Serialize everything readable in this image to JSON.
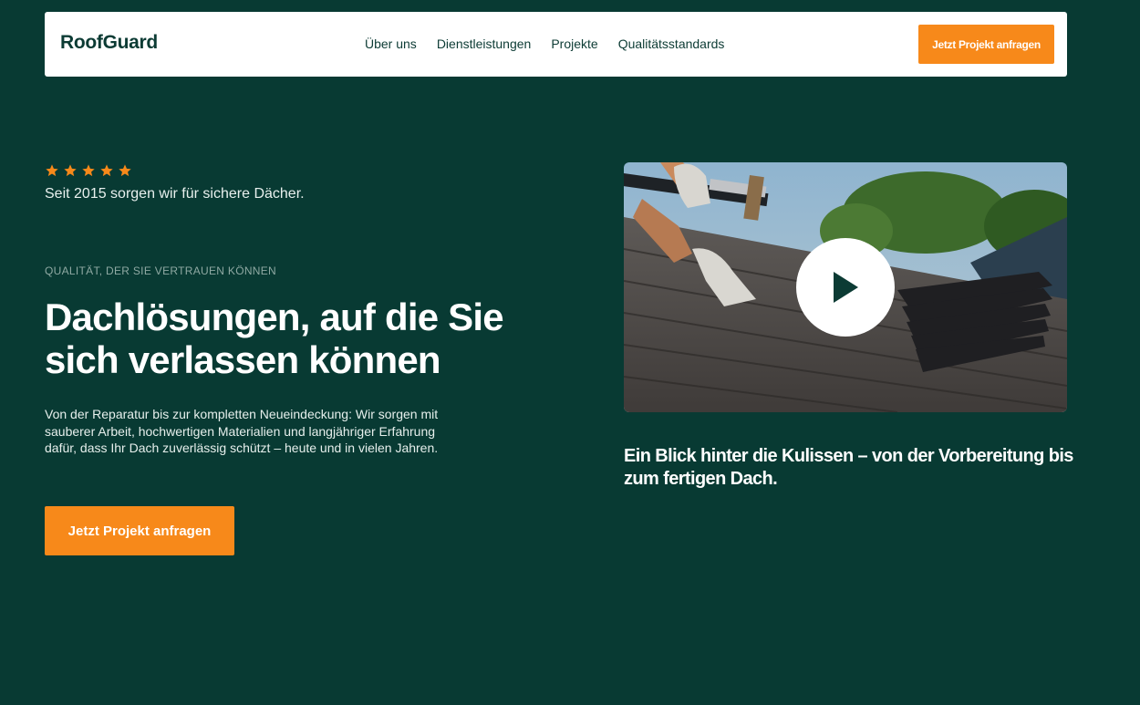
{
  "brand": {
    "name": "RoofGuard"
  },
  "nav": {
    "links": [
      "Über uns",
      "Dienstleistungen",
      "Projekte",
      "Qualitätsstandards"
    ],
    "cta_label": "Jetzt Projekt anfragen"
  },
  "hero": {
    "rating_stars": 5,
    "since_text": "Seit 2015 sorgen wir für sichere Dächer.",
    "eyebrow": "QUALITÄT, DER SIE VERTRAUEN KÖNNEN",
    "headline": "Dachlösungen, auf die Sie sich verlassen können",
    "description": "Von der Reparatur bis zur kompletten Neueindeckung: Wir sorgen mit sauberer Arbeit, hochwertigen Materialien und langjähriger Erfahrung dafür, dass Ihr Dach zuverlässig schützt – heute und in vielen Jahren.",
    "cta_label": "Jetzt Projekt anfragen"
  },
  "video": {
    "icon": "play-icon",
    "caption": "Ein Blick hinter die Kulissen – von der Vorbereitung bis zum fertigen Dach."
  },
  "colors": {
    "background": "#083a33",
    "accent": "#f7891a",
    "brand_dark": "#0c3b34"
  }
}
